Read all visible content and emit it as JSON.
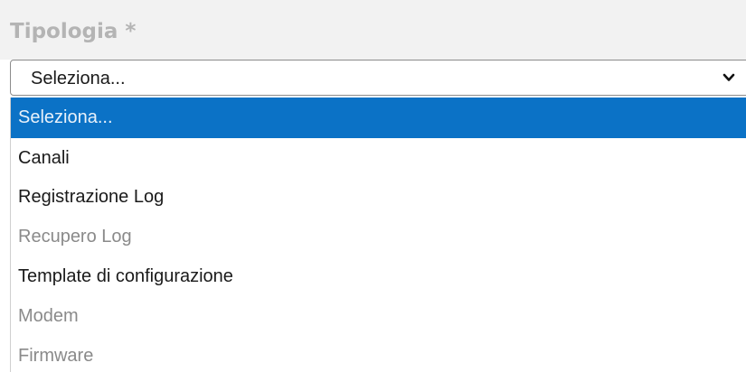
{
  "field": {
    "label": "Tipologia *",
    "selected_value": "Seleziona..."
  },
  "dropdown": {
    "options": [
      {
        "label": "Seleziona...",
        "state": "highlighted"
      },
      {
        "label": "Canali",
        "state": "enabled"
      },
      {
        "label": "Registrazione Log",
        "state": "enabled"
      },
      {
        "label": "Recupero Log",
        "state": "disabled"
      },
      {
        "label": "Template di configurazione",
        "state": "enabled"
      },
      {
        "label": "Modem",
        "state": "disabled"
      },
      {
        "label": "Firmware",
        "state": "disabled"
      }
    ]
  },
  "colors": {
    "highlight": "#0b72c6",
    "label_gray": "#b4b4b4",
    "disabled_text": "#8a8a8a"
  },
  "icons": {
    "select_toggle": "chevron-down-icon"
  }
}
